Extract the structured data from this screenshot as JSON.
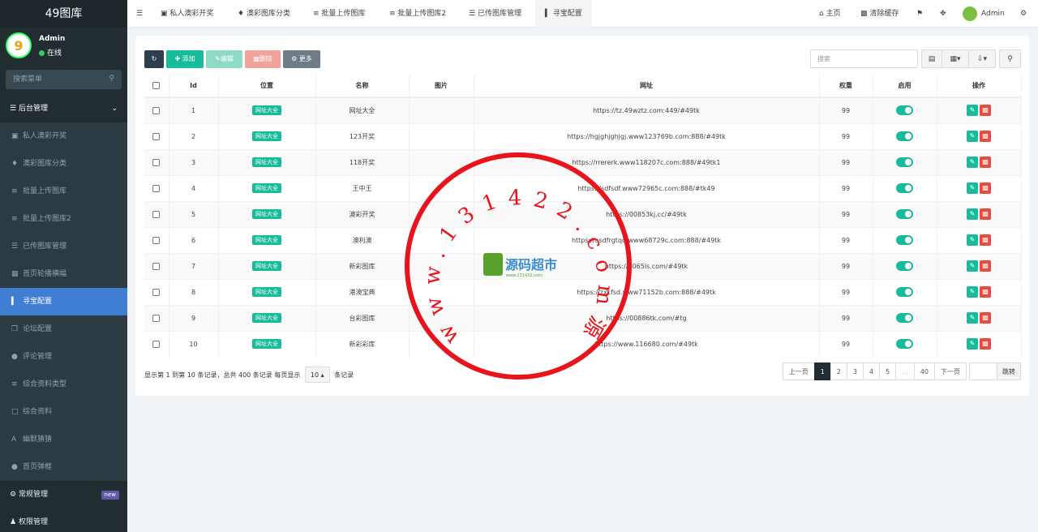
{
  "sidebar": {
    "brand": "49图库",
    "user": {
      "name": "Admin",
      "status": "在线",
      "avatar_text": "9"
    },
    "search": {
      "placeholder": "搜索菜单",
      "icon": "search-icon"
    },
    "section": {
      "label": "后台管理"
    },
    "items": [
      {
        "label": "私人澳彩开奖",
        "icon": "briefcase-icon"
      },
      {
        "label": "澳彩图库分类",
        "icon": "bell-icon"
      },
      {
        "label": "批量上传图库",
        "icon": "database-icon"
      },
      {
        "label": "批量上传图库2",
        "icon": "database-icon"
      },
      {
        "label": "已传图库管理",
        "icon": "list-icon"
      },
      {
        "label": "首页轮播横幅",
        "icon": "windows-icon"
      },
      {
        "label": "寻宝配置",
        "icon": "chart-icon",
        "active": true
      },
      {
        "label": "论坛配置",
        "icon": "clone-icon"
      },
      {
        "label": "评论管理",
        "icon": "comments-icon"
      },
      {
        "label": "综合资料类型",
        "icon": "list-ol-icon"
      },
      {
        "label": "综合资料",
        "icon": "file-icon"
      },
      {
        "label": "幽默猜猜",
        "icon": "font-icon"
      },
      {
        "label": "首页弹框",
        "icon": "comment-icon"
      }
    ],
    "groups": [
      {
        "label": "常规管理",
        "badge": "new",
        "icon": "cogs-icon"
      },
      {
        "label": "权限管理",
        "icon": "group-icon"
      }
    ]
  },
  "topbar": {
    "tabs": [
      {
        "label": "私人澳彩开奖"
      },
      {
        "label": "澳彩图库分类"
      },
      {
        "label": "批量上传图库"
      },
      {
        "label": "批量上传图库2"
      },
      {
        "label": "已传图库管理"
      },
      {
        "label": "寻宝配置",
        "active": true
      }
    ],
    "home": "主页",
    "clear_cache": "清除缓存",
    "admin": "Admin"
  },
  "toolbar": {
    "add": "添加",
    "edit": "编辑",
    "delete": "删除",
    "more": "更多",
    "search_placeholder": "搜索"
  },
  "table": {
    "headers": [
      "Id",
      "位置",
      "名称",
      "图片",
      "网址",
      "权重",
      "启用",
      "操作"
    ],
    "rows": [
      {
        "id": "1",
        "pos": "网址大全",
        "name": "网址大全",
        "url": "https://tz.49wztz.com:449/#49tk",
        "weight": "99"
      },
      {
        "id": "2",
        "pos": "网址大全",
        "name": "123开奖",
        "url": "https://hgjghjghjgj.www123769b.com:888/#49tk",
        "weight": "99"
      },
      {
        "id": "3",
        "pos": "网址大全",
        "name": "118开奖",
        "url": "https://rrererk.www118207c.com:888/#49tk1",
        "weight": "99"
      },
      {
        "id": "4",
        "pos": "网址大全",
        "name": "王中王",
        "url": "https://sdfsdf.www72965c.com:888/#tk49",
        "weight": "99"
      },
      {
        "id": "5",
        "pos": "网址大全",
        "name": "澳彩开奖",
        "url": "https://00853kj.cc/#49tk",
        "weight": "99"
      },
      {
        "id": "6",
        "pos": "网址大全",
        "name": "澳利澳",
        "url": "https://asdfrgtqd.www68729c.com:888/#49tk",
        "weight": "99"
      },
      {
        "id": "7",
        "pos": "网址大全",
        "name": "新彩图库",
        "url": "https://0065ls.com/#49tk",
        "weight": "99"
      },
      {
        "id": "8",
        "pos": "网址大全",
        "name": "港澳宝典",
        "url": "https://zxcfsd.www71152b.com:888/#49tk",
        "weight": "99"
      },
      {
        "id": "9",
        "pos": "网址大全",
        "name": "台彩图库",
        "url": "https://00886tk.com/#tg",
        "weight": "99"
      },
      {
        "id": "10",
        "pos": "网址大全",
        "name": "新彩彩库",
        "url": "https://www.116680.com/#49tk",
        "weight": "99"
      }
    ]
  },
  "pagination": {
    "info_prefix": "显示第 1 到第 10 条记录，总共 400 条记录 每页显示",
    "per_page": "10",
    "info_suffix": "条记录",
    "prev": "上一页",
    "next": "下一页",
    "pages": [
      "1",
      "2",
      "3",
      "4",
      "5",
      "...",
      "40"
    ],
    "jump": "跳转"
  },
  "watermark": {
    "text": "www.131422.com源码超市",
    "logo": "源码超市",
    "logo_sub": "www.131422.com"
  },
  "colors": {
    "sidebar": "#222d32",
    "active": "#3f7ed3",
    "success": "#18bc9c",
    "danger": "#e74c3c",
    "stamp": "#e8141c"
  }
}
